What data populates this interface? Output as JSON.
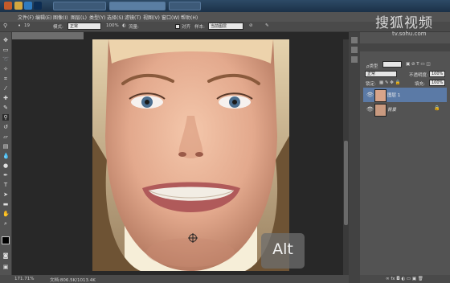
{
  "menubar": {
    "items": [
      "文件(F)",
      "编辑(E)",
      "图像(I)",
      "图层(L)",
      "类型(Y)",
      "选择(S)",
      "滤镜(T)",
      "视图(V)",
      "窗口(W)",
      "帮助(H)"
    ]
  },
  "options": {
    "mode_label": "模式:",
    "mode_value": "正常",
    "flow_label": "流量:",
    "align_label": "对齐",
    "sample_label": "样本:",
    "sample_value": "当前图层"
  },
  "statusbar": {
    "zoom": "171.71%",
    "doc": "文档:806.5K/1013.4K"
  },
  "layers_panel": {
    "filter_label": "ρ类型",
    "blend_mode": "正常",
    "opacity_label": "不透明度:",
    "opacity_value": "100%",
    "lock_label": "锁定:",
    "fill_label": "填充:",
    "fill_value": "100%",
    "layers": [
      {
        "name": "图层 1",
        "selected": true
      },
      {
        "name": "背景",
        "selected": false,
        "locked": true
      }
    ]
  },
  "watermark": {
    "brand": "搜狐视频",
    "url": "tv.sohu.com"
  },
  "overlay": {
    "key_badge": "Alt"
  },
  "colors": {
    "accent_selected_layer": "#5b7aa6",
    "panel_bg": "#535353",
    "canvas_bg": "#282828"
  },
  "icons": [
    "clone-stamp-icon",
    "eye-icon",
    "lock-icon",
    "crosshair-cursor-icon"
  ]
}
